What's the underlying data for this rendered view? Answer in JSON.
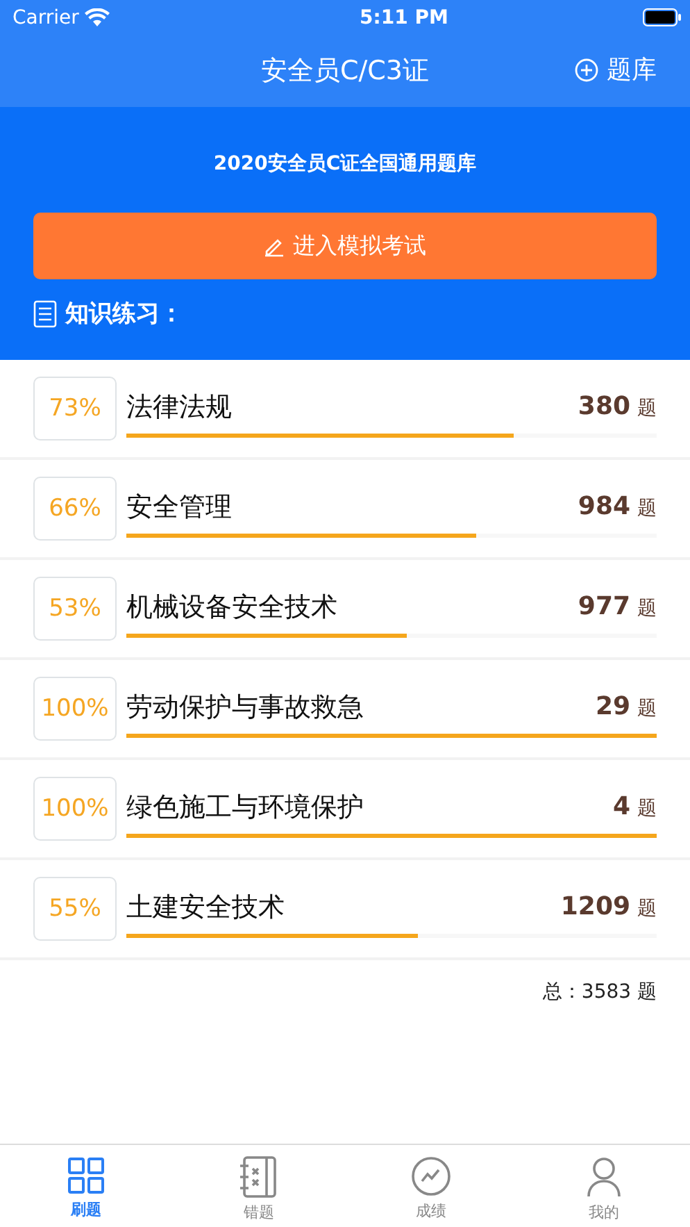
{
  "status_bar": {
    "carrier": "Carrier",
    "time": "5:11 PM"
  },
  "nav": {
    "title": "安全员C/C3证",
    "action": "题库"
  },
  "header": {
    "subtitle": "2020安全员C证全国通用题库",
    "exam_button": "进入模拟考试",
    "section_title": "知识练习："
  },
  "categories": [
    {
      "percent": "73%",
      "name": "法律法规",
      "count": "380",
      "unit": "题",
      "level": 0.73
    },
    {
      "percent": "66%",
      "name": "安全管理",
      "count": "984",
      "unit": "题",
      "level": 0.66
    },
    {
      "percent": "53%",
      "name": "机械设备安全技术",
      "count": "977",
      "unit": "题",
      "level": 0.53
    },
    {
      "percent": "100%",
      "name": "劳动保护与事故救急",
      "count": "29",
      "unit": "题",
      "level": 1
    },
    {
      "percent": "100%",
      "name": "绿色施工与环境保护",
      "count": "4",
      "unit": "题",
      "level": 1
    },
    {
      "percent": "55%",
      "name": "土建安全技术",
      "count": "1209",
      "unit": "题",
      "level": 0.55
    }
  ],
  "total": "总：3583 题",
  "tabs": [
    {
      "label": "刷题",
      "kind": "grid",
      "selected": true
    },
    {
      "label": "错题",
      "kind": "notebook",
      "selected": false
    },
    {
      "label": "成绩",
      "kind": "chart",
      "selected": false
    },
    {
      "label": "我的",
      "kind": "person",
      "selected": false
    }
  ]
}
